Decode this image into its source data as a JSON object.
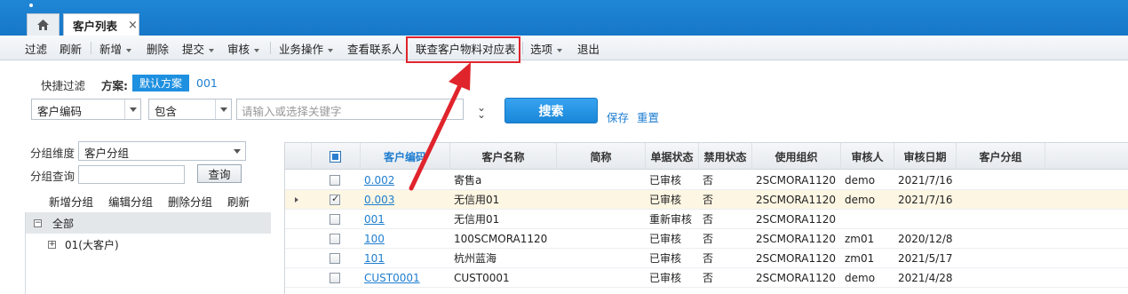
{
  "tabs": {
    "home_icon": "home-icon",
    "active_label": "客户列表",
    "close": "×"
  },
  "toolbar": {
    "items": [
      "过滤",
      "刷新",
      "新增",
      "删除",
      "提交",
      "审核",
      "业务操作",
      "查看联系人",
      "联查客户物料对应表",
      "选项",
      "退出"
    ]
  },
  "filter": {
    "quick_label": "快捷过滤",
    "plan_label": "方案:",
    "plan_default": "默认方案",
    "plan_alt": "001",
    "field_select": "客户编码",
    "op_select": "包含",
    "keyword_placeholder": "请输入或选择关键字",
    "search_button": "搜索",
    "save": "保存",
    "reset": "重置"
  },
  "group": {
    "dimension_label": "分组维度",
    "dimension_value": "客户分组",
    "query_label": "分组查询",
    "query_button": "查询",
    "actions": [
      "新增分组",
      "编辑分组",
      "删除分组",
      "刷新"
    ],
    "tree_root": "全部",
    "tree_child": "01(大客户)"
  },
  "grid": {
    "headers": [
      "客户编码",
      "客户名称",
      "简称",
      "单据状态",
      "禁用状态",
      "使用组织",
      "审核人",
      "审核日期",
      "客户分组"
    ],
    "rows": [
      {
        "code": "0.002",
        "name": "寄售a",
        "short": "",
        "status": "已审核",
        "disabled": "否",
        "org": "2SCMORA1120",
        "auditor": "demo",
        "date": "2021/7/16",
        "group": "",
        "checked": false
      },
      {
        "code": "0.003",
        "name": "无信用01",
        "short": "",
        "status": "已审核",
        "disabled": "否",
        "org": "2SCMORA1120",
        "auditor": "demo",
        "date": "2021/7/16",
        "group": "",
        "checked": true
      },
      {
        "code": "001",
        "name": "无信用01",
        "short": "",
        "status": "重新审核",
        "disabled": "否",
        "org": "2SCMORA1120",
        "auditor": "",
        "date": "",
        "group": "",
        "checked": false
      },
      {
        "code": "100",
        "name": "100SCMORA1120",
        "short": "",
        "status": "已审核",
        "disabled": "否",
        "org": "2SCMORA1120",
        "auditor": "zm01",
        "date": "2020/12/8",
        "group": "",
        "checked": false
      },
      {
        "code": "101",
        "name": "杭州蓝海",
        "short": "",
        "status": "已审核",
        "disabled": "否",
        "org": "2SCMORA1120",
        "auditor": "zm01",
        "date": "2021/5/17",
        "group": "",
        "checked": false
      },
      {
        "code": "CUST0001",
        "name": "CUST0001",
        "short": "",
        "status": "已审核",
        "disabled": "否",
        "org": "2SCMORA1120",
        "auditor": "demo",
        "date": "2021/4/28",
        "group": "",
        "checked": false
      }
    ]
  },
  "colors": {
    "accent": "#1e90e0",
    "highlight": "#e0242c",
    "topbar": "#1a7fcf"
  }
}
